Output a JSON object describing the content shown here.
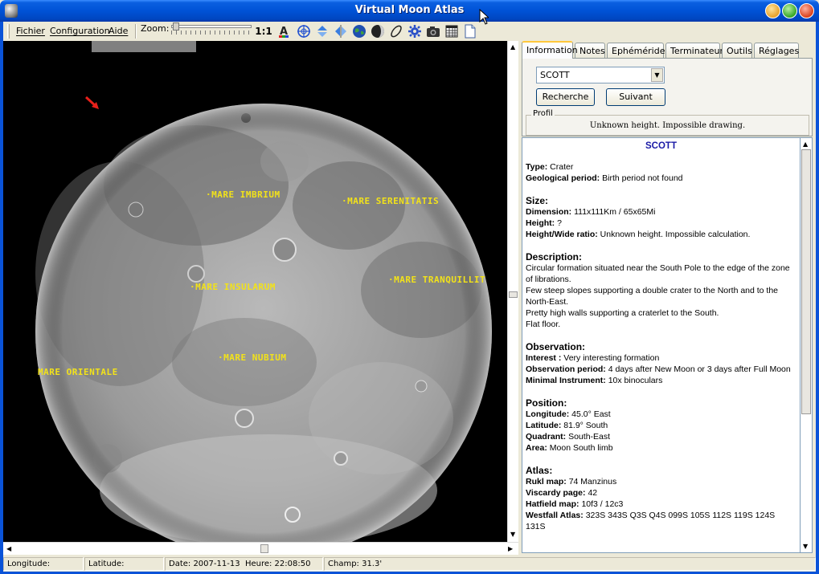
{
  "window": {
    "title": "Virtual Moon Atlas"
  },
  "menu": {
    "items": [
      "Fichier",
      "Configuration",
      "Aide"
    ]
  },
  "toolbar": {
    "zoom_label": "Zoom:",
    "one_to_one": "1:1",
    "icons": [
      "text-color-icon",
      "grid-icon",
      "flip-vertical-icon",
      "flip-horizontal-icon",
      "globe-icon",
      "phase-icon",
      "orbit-icon",
      "settings-icon",
      "camera-icon",
      "calendar-icon",
      "document-icon"
    ]
  },
  "map": {
    "labels": [
      {
        "name": "mare-imbrium",
        "text": "·MARE IMBRIUM"
      },
      {
        "name": "mare-serenitatis",
        "text": "·MARE SERENITATIS"
      },
      {
        "name": "mare-insularum",
        "text": "·MARE INSULARUM"
      },
      {
        "name": "mare-tranquillitatis",
        "text": "·MARE TRANQUILLIT"
      },
      {
        "name": "mare-nubium",
        "text": "·MARE NUBIUM"
      },
      {
        "name": "mare-orientale",
        "text": "MARE ORIENTALE"
      }
    ],
    "marker_color": "#e8201a"
  },
  "status": {
    "longitude": "Longitude:",
    "latitude": "Latitude:",
    "date": "Date: 2007-11-13",
    "time": "Heure: 22:08:50",
    "field": "Champ: 31.3'"
  },
  "panel": {
    "tabs": [
      "Information",
      "Notes",
      "Ephémérides",
      "Terminateur",
      "Outils",
      "Réglages"
    ],
    "active_tab": "Information",
    "search_value": "SCOTT",
    "search_button": "Recherche",
    "next_button": "Suivant",
    "profile_title": "Profil",
    "profile_text": "Unknown height. Impossible drawing."
  },
  "info": {
    "title": "SCOTT",
    "type_label": "Type:",
    "type": "Crater",
    "geo_label": "Geological period:",
    "geo": "Birth period not found",
    "size_head": "Size:",
    "dim_label": "Dimension:",
    "dim": "111x111Km / 65x65Mi",
    "height_label": "Height:",
    "height": "?",
    "ratio_label": "Height/Wide ratio:",
    "ratio": "Unknown height. Impossible calculation.",
    "desc_head": "Description:",
    "desc": [
      "Circular formation situated near the South Pole to the edge of the zone of librations.",
      "Few steep slopes supporting a double crater to the North and to the North-East.",
      "Pretty high walls supporting a craterlet to the South.",
      "Flat floor."
    ],
    "obs_head": "Observation:",
    "interest_label": "Interest :",
    "interest": "Very interesting formation",
    "obsperiod_label": "Observation period:",
    "obsperiod": "4 days after New Moon or 3 days after Full Moon",
    "mininst_label": "Minimal Instrument:",
    "mininst": "10x binoculars",
    "pos_head": "Position:",
    "lon_label": "Longitude:",
    "lon": "45.0° East",
    "lat_label": "Latitude:",
    "lat": "81.9° South",
    "quad_label": "Quadrant:",
    "quad": "South-East",
    "area_label": "Area:",
    "area": "Moon South limb",
    "atlas_head": "Atlas:",
    "rukl_label": "Rukl map:",
    "rukl": "74 Manzinus",
    "viscardy_label": "Viscardy page:",
    "viscardy": "42",
    "hatfield_label": "Hatfield map:",
    "hatfield": "10f3 / 12c3",
    "westfall_label": "Westfall Atlas:",
    "westfall": "323S 343S Q3S Q4S 099S 105S 112S 119S 124S 131S"
  }
}
